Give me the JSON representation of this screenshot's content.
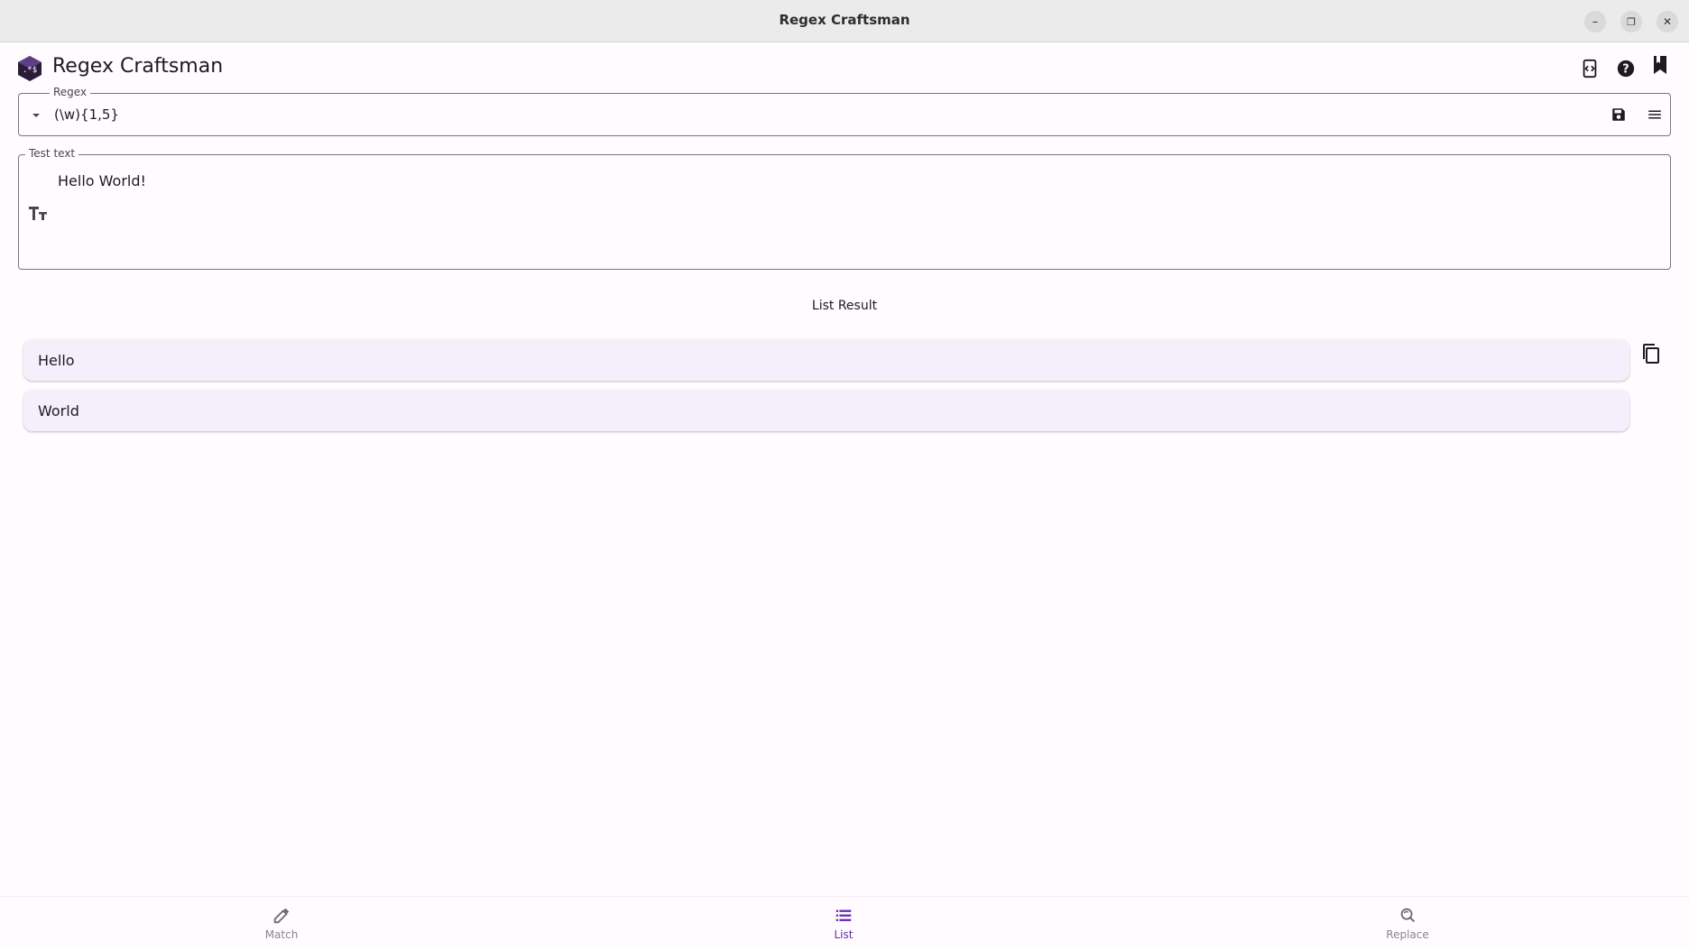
{
  "window": {
    "title": "Regex Craftsman",
    "minimize_glyph": "–",
    "maximize_glyph": "❐",
    "close_glyph": "✕"
  },
  "appbar": {
    "title": "Regex Craftsman",
    "icons": [
      "code-view-icon",
      "help-icon",
      "bookmark-icon"
    ]
  },
  "regex": {
    "label": "Regex",
    "value": "(\\w){1,5}",
    "icons": [
      "dropdown-arrow-icon",
      "save-icon",
      "menu-icon"
    ]
  },
  "test_text": {
    "label": "Test text",
    "value": "Hello World!",
    "icons": [
      "text-size-icon"
    ]
  },
  "results": {
    "title": "List Result",
    "items": [
      "Hello",
      "World"
    ],
    "icons": [
      "copy-icon"
    ]
  },
  "bottom_nav": {
    "items": [
      {
        "label": "Match",
        "icon": "eyedropper-icon",
        "active": false
      },
      {
        "label": "List",
        "icon": "list-icon",
        "active": true
      },
      {
        "label": "Replace",
        "icon": "find-replace-icon",
        "active": false
      }
    ]
  },
  "colors": {
    "accent": "#6a2ab5",
    "item_bg": "#f4effa",
    "background": "#fffbfe"
  }
}
